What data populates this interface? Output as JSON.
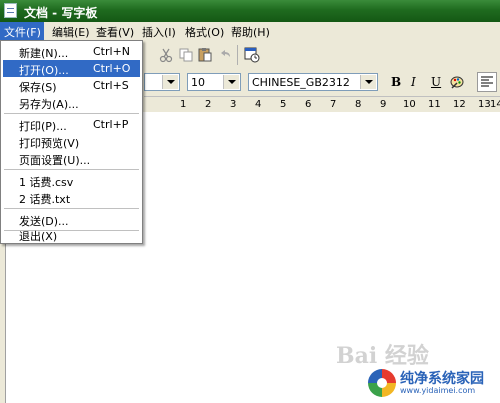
{
  "window": {
    "title": "文档 - 写字板"
  },
  "menubar": {
    "items": [
      "文件(F)",
      "编辑(E)",
      "查看(V)",
      "插入(I)",
      "格式(O)",
      "帮助(H)"
    ]
  },
  "file_menu": {
    "items": [
      {
        "label": "新建(N)...",
        "shortcut": "Ctrl+N"
      },
      {
        "label": "打开(O)...",
        "shortcut": "Ctrl+O"
      },
      {
        "label": "保存(S)",
        "shortcut": "Ctrl+S"
      },
      {
        "label": "另存为(A)...",
        "shortcut": ""
      },
      {
        "label": "打印(P)...",
        "shortcut": "Ctrl+P"
      },
      {
        "label": "打印预览(V)",
        "shortcut": ""
      },
      {
        "label": "页面设置(U)...",
        "shortcut": ""
      },
      {
        "label": "1 话费.csv",
        "shortcut": ""
      },
      {
        "label": "2 话费.txt",
        "shortcut": ""
      },
      {
        "label": "发送(D)...",
        "shortcut": ""
      },
      {
        "label": "退出(X)",
        "shortcut": ""
      }
    ],
    "highlighted_index": 1
  },
  "format_bar": {
    "font_size": "10",
    "script": "CHINESE_GB2312",
    "bold_label": "B",
    "italic_label": "I",
    "underline_label": "U"
  },
  "ruler": {
    "numbers": [
      "1",
      "2",
      "3",
      "4",
      "5",
      "6",
      "7",
      "8",
      "9",
      "10",
      "11",
      "12",
      "13",
      "14"
    ]
  },
  "watermarks": {
    "baidu": "Bai 经验",
    "site_name": "纯净系统家园",
    "site_url": "www.yidaimei.com"
  },
  "colors": {
    "titlebar": "#1f6b1f",
    "highlight": "#316ac5"
  }
}
